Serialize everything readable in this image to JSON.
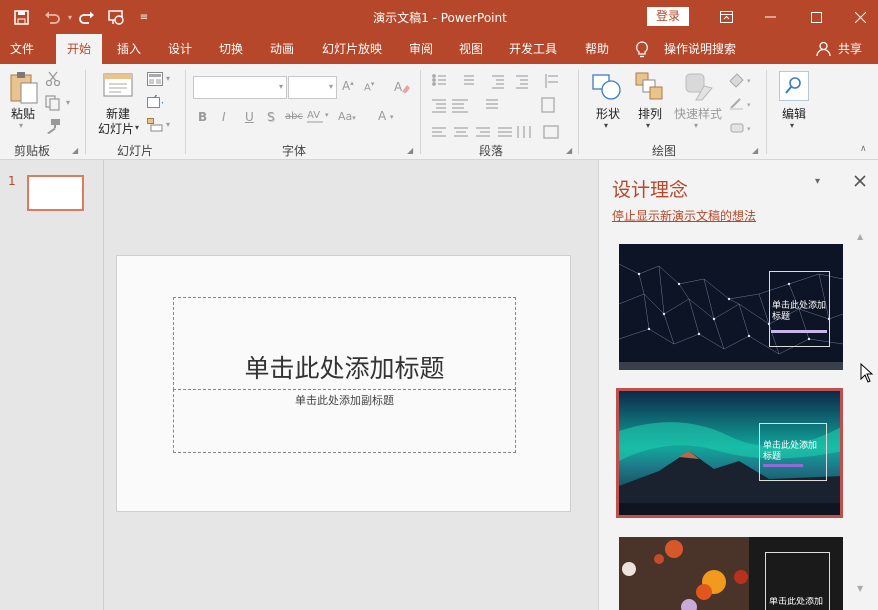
{
  "titlebar": {
    "document_title": "演示文稿1  -  PowerPoint",
    "login_label": "登录",
    "quick_access": [
      "save-icon",
      "undo-icon",
      "redo-icon",
      "present-from-start-icon",
      "customize-qat-icon"
    ]
  },
  "tabs": [
    "文件",
    "开始",
    "插入",
    "设计",
    "切换",
    "动画",
    "幻灯片放映",
    "审阅",
    "视图",
    "开发工具",
    "帮助"
  ],
  "tell_me": "操作说明搜索",
  "share_label": "共享",
  "ribbon": {
    "clipboard": {
      "paste_label": "粘贴",
      "group_label": "剪贴板"
    },
    "slides": {
      "new_slide_line1": "新建",
      "new_slide_line2": "幻灯片",
      "group_label": "幻灯片"
    },
    "font": {
      "group_label": "字体",
      "bold": "B",
      "italic": "I",
      "underline": "U",
      "shadow": "S",
      "strike": "abc"
    },
    "paragraph": {
      "group_label": "段落"
    },
    "drawing": {
      "shapes_label": "形状",
      "arrange_label": "排列",
      "quick_styles_label": "快速样式",
      "group_label": "绘图"
    },
    "editing": {
      "label": "编辑"
    }
  },
  "thumbnails": {
    "slide_number": "1"
  },
  "slide": {
    "title_placeholder": "单击此处添加标题",
    "subtitle_placeholder": "单击此处添加副标题"
  },
  "design_pane": {
    "title": "设计理念",
    "stop_link": "停止显示新演示文稿的想法",
    "cards": [
      {
        "title": "单击此处添加标题"
      },
      {
        "title": "单击此处添加标题"
      },
      {
        "title": "单击此处添加标题"
      }
    ]
  },
  "colors": {
    "accent": "#b7472a",
    "ribbon_bg": "#f3f3f3",
    "workspace_bg": "#e6e6e6"
  }
}
